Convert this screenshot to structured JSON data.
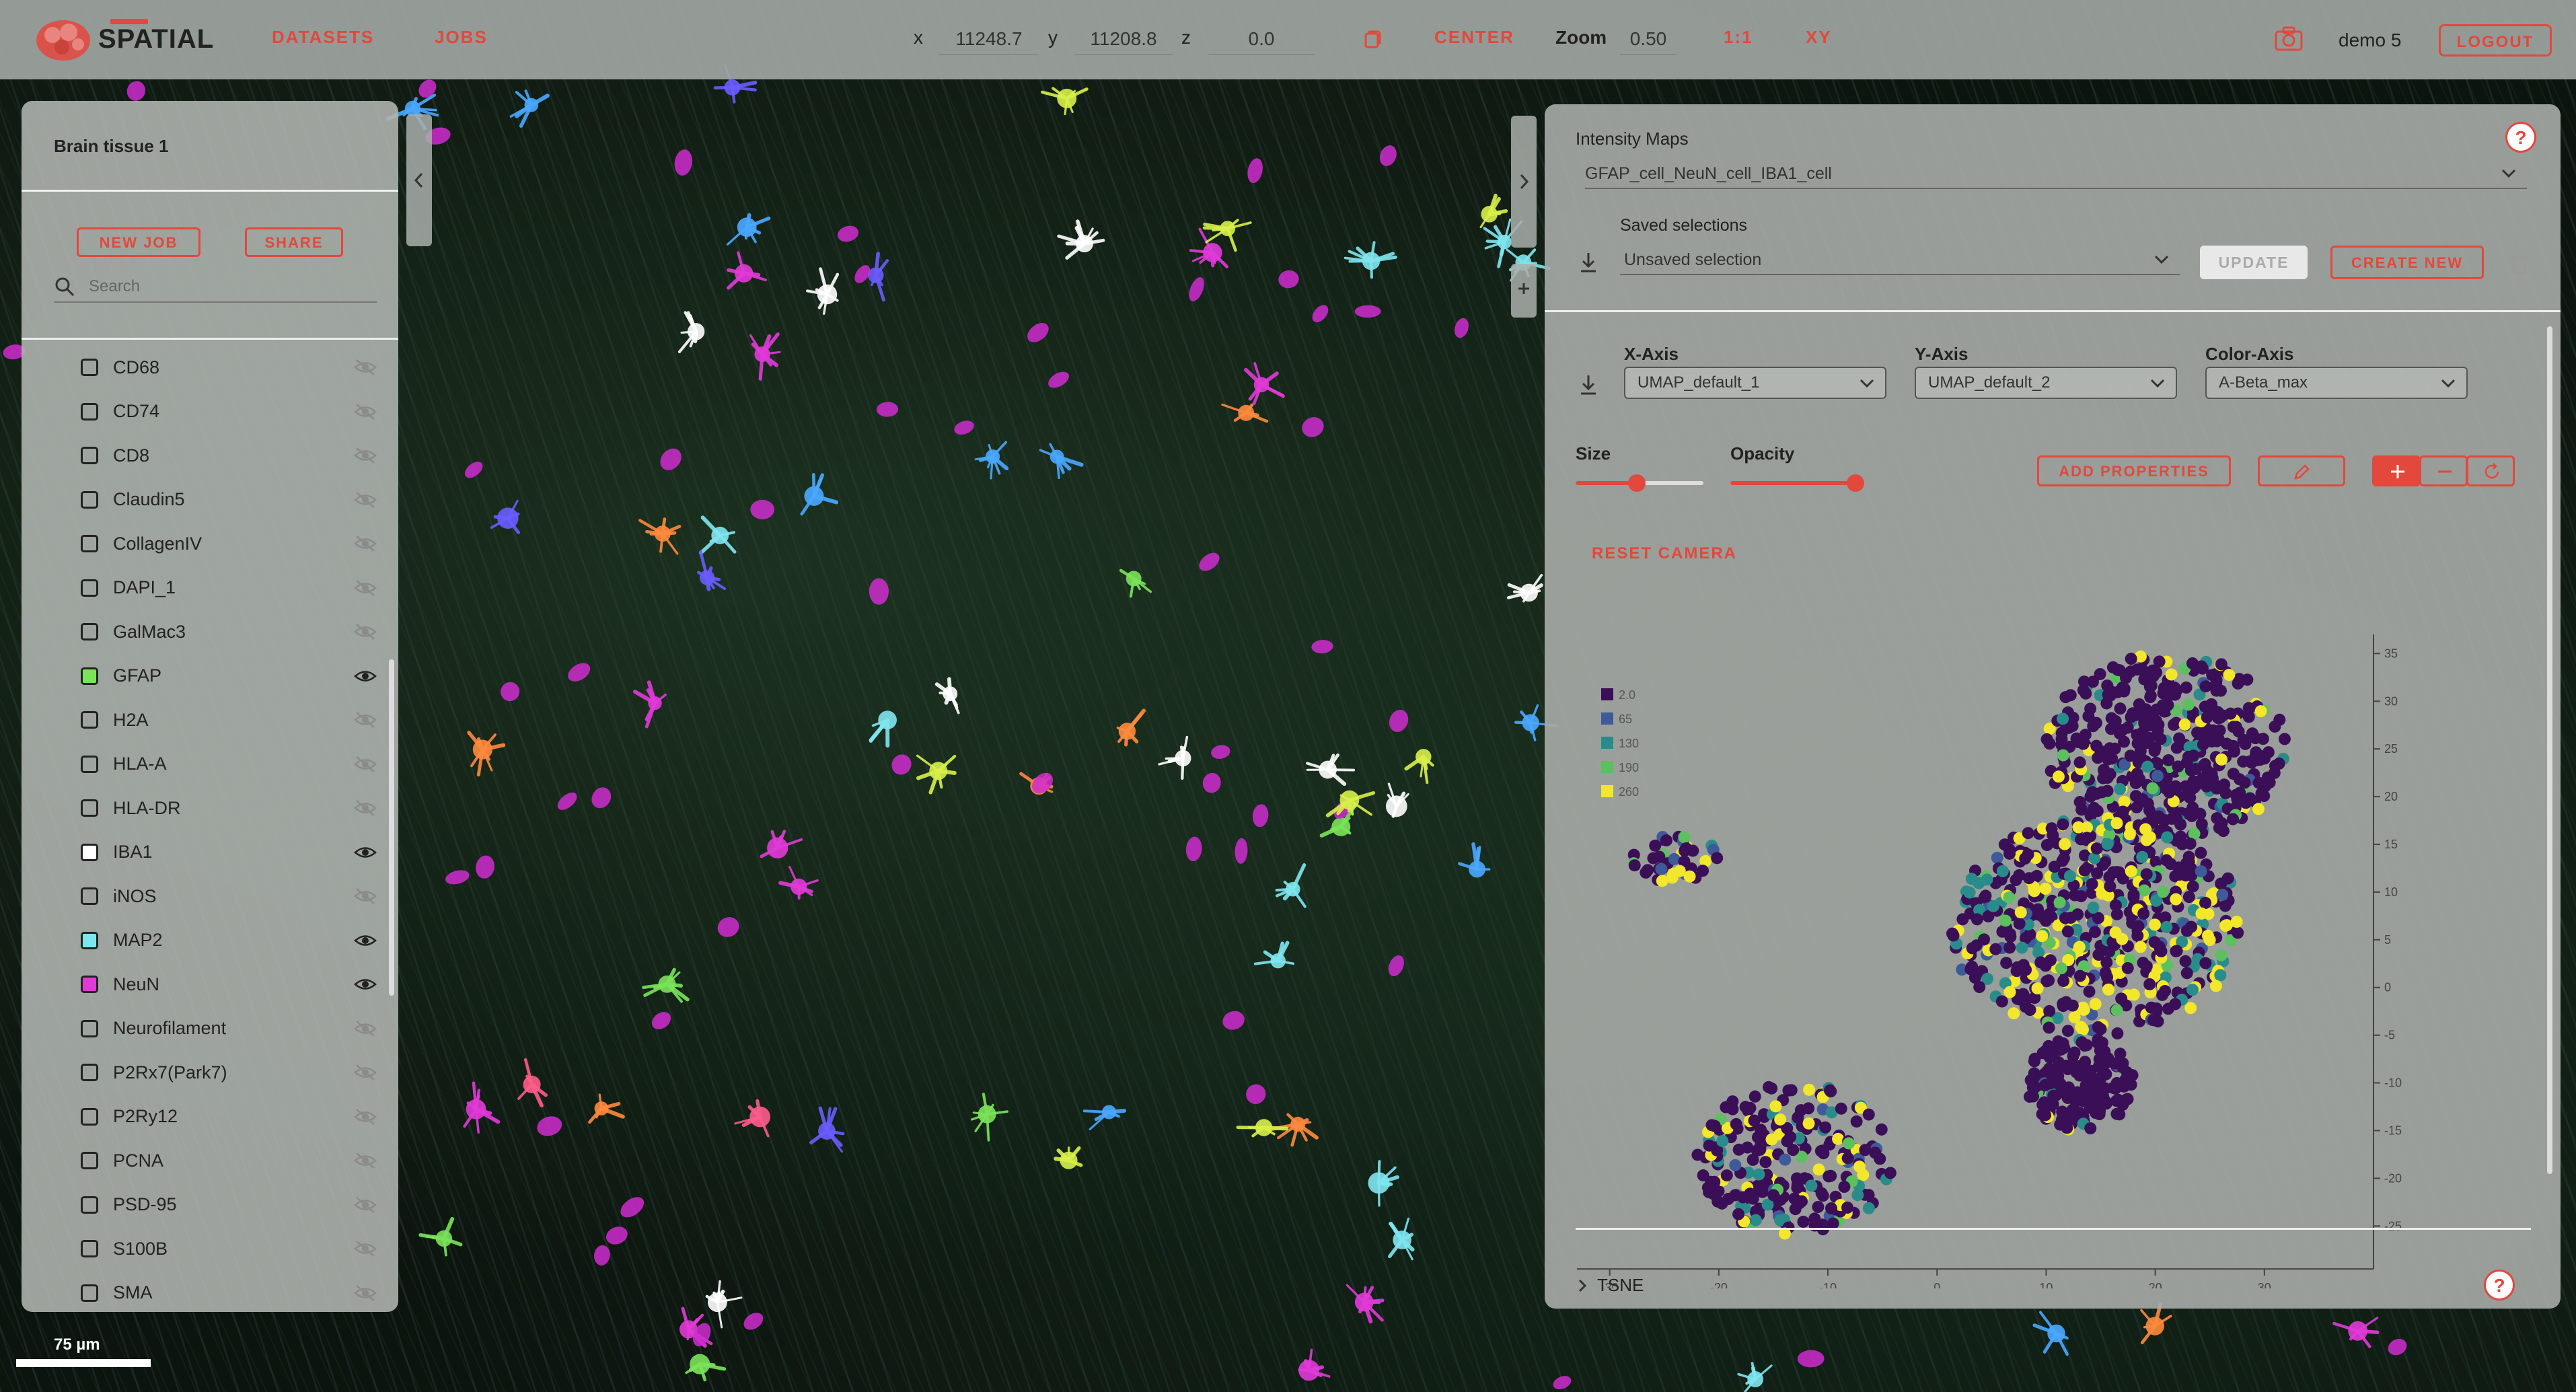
{
  "app": {
    "name": "SPATIAL"
  },
  "nav": {
    "datasets": "DATASETS",
    "jobs": "JOBS"
  },
  "coords": {
    "x_label": "x",
    "x_value": "11248.7",
    "y_label": "y",
    "y_value": "11208.8",
    "z_label": "z",
    "z_value": "0.0"
  },
  "toolbar": {
    "center": "CENTER",
    "zoom_label": "Zoom",
    "zoom_value": "0.50",
    "ratio": "1:1",
    "xy": "XY"
  },
  "user": {
    "name": "demo 5",
    "logout": "LOGOUT"
  },
  "left_panel": {
    "title": "Brain tissue 1",
    "new_job": "NEW JOB",
    "share": "SHARE",
    "search_placeholder": "Search",
    "channels": [
      {
        "label": "CD68",
        "color": null,
        "visible": false
      },
      {
        "label": "CD74",
        "color": null,
        "visible": false
      },
      {
        "label": "CD8",
        "color": null,
        "visible": false
      },
      {
        "label": "Claudin5",
        "color": null,
        "visible": false
      },
      {
        "label": "CollagenIV",
        "color": null,
        "visible": false
      },
      {
        "label": "DAPI_1",
        "color": null,
        "visible": false
      },
      {
        "label": "GalMac3",
        "color": null,
        "visible": false
      },
      {
        "label": "GFAP",
        "color": "#7be35a",
        "visible": true
      },
      {
        "label": "H2A",
        "color": null,
        "visible": false
      },
      {
        "label": "HLA-A",
        "color": null,
        "visible": false
      },
      {
        "label": "HLA-DR",
        "color": null,
        "visible": false
      },
      {
        "label": "IBA1",
        "color": "#ffffff",
        "visible": true
      },
      {
        "label": "iNOS",
        "color": null,
        "visible": false
      },
      {
        "label": "MAP2",
        "color": "#7fe6f0",
        "visible": true
      },
      {
        "label": "NeuN",
        "color": "#e23ad8",
        "visible": true
      },
      {
        "label": "Neurofilament",
        "color": null,
        "visible": false
      },
      {
        "label": "P2Rx7(Park7)",
        "color": null,
        "visible": false
      },
      {
        "label": "P2Ry12",
        "color": null,
        "visible": false
      },
      {
        "label": "PCNA",
        "color": null,
        "visible": false
      },
      {
        "label": "PSD-95",
        "color": null,
        "visible": false
      },
      {
        "label": "S100B",
        "color": null,
        "visible": false
      },
      {
        "label": "SMA",
        "color": null,
        "visible": false
      }
    ]
  },
  "right_panel": {
    "intensity_maps_label": "Intensity Maps",
    "intensity_map_value": "GFAP_cell_NeuN_cell_IBA1_cell",
    "saved_selections_label": "Saved selections",
    "saved_selection_value": "Unsaved selection",
    "update": "UPDATE",
    "create_new": "CREATE NEW",
    "x_axis_label": "X-Axis",
    "x_axis_value": "UMAP_default_1",
    "y_axis_label": "Y-Axis",
    "y_axis_value": "UMAP_default_2",
    "color_axis_label": "Color-Axis",
    "color_axis_value": "A-Beta_max",
    "size_label": "Size",
    "size_value": 0.48,
    "opacity_label": "Opacity",
    "opacity_value": 0.98,
    "add_properties": "ADD PROPERTIES",
    "reset_camera": "RESET CAMERA",
    "tsne_label": "TSNE",
    "help": "?"
  },
  "chart_data": {
    "type": "scatter",
    "title": "",
    "xlabel": "",
    "ylabel": "",
    "xlim": [
      -33,
      40
    ],
    "ylim": [
      -29,
      37
    ],
    "xticks": [
      -30,
      -20,
      -10,
      0,
      10,
      20,
      30
    ],
    "yticks": [
      35,
      30,
      25,
      20,
      15,
      10,
      5,
      0,
      -5,
      -10,
      -15,
      -20,
      -25
    ],
    "legend": [
      {
        "label": "2.0",
        "color": "#3b0f57"
      },
      {
        "label": "65",
        "color": "#3e5a98"
      },
      {
        "label": "130",
        "color": "#2a8c8a"
      },
      {
        "label": "190",
        "color": "#5cc05f"
      },
      {
        "label": "260",
        "color": "#f2e72a"
      }
    ],
    "legend_position": "top-left",
    "clusters": [
      {
        "region": "main-upper",
        "x_range": [
          10,
          32
        ],
        "y_range": [
          15,
          35
        ],
        "color_mix": "mostly 2.0, few 260 and 190"
      },
      {
        "region": "main-middle",
        "x_range": [
          1,
          28
        ],
        "y_range": [
          -5,
          18
        ],
        "color_mix": "2.0 with many 260 and 130"
      },
      {
        "region": "main-lower",
        "x_range": [
          8,
          18
        ],
        "y_range": [
          -15,
          -5
        ],
        "color_mix": "mostly 2.0"
      },
      {
        "region": "small-left",
        "x_range": [
          -28,
          -20
        ],
        "y_range": [
          11,
          16
        ],
        "color_mix": "2.0 with some 260 and 65"
      },
      {
        "region": "bottom-left",
        "x_range": [
          -22,
          -4
        ],
        "y_range": [
          -26,
          -10
        ],
        "color_mix": "2.0 with some 260 and 130"
      }
    ]
  },
  "scalebar": {
    "label": "75 µm"
  },
  "colors": {
    "accent": "#e2483c"
  }
}
